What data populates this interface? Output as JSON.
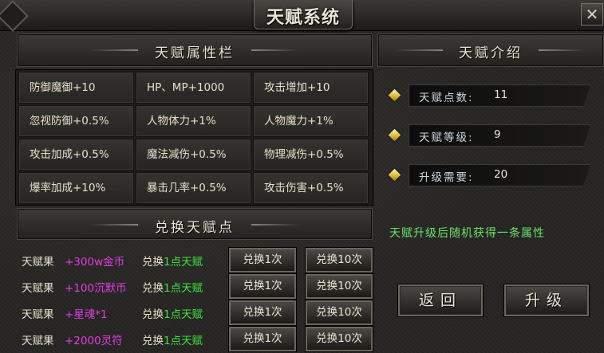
{
  "window": {
    "title": "天赋系统",
    "close_glyph": "✕"
  },
  "attr_panel": {
    "header": "天赋属性栏",
    "cells": [
      "防御魔御+10",
      "HP、MP+1000",
      "攻击增加+10",
      "忽视防御+0.5%",
      "人物体力+1%",
      "人物魔力+1%",
      "攻击加成+0.5%",
      "魔法减伤+0.5%",
      "物理减伤+0.5%",
      "爆率加成+10%",
      "暴击几率+0.5%",
      "攻击伤害+0.5%"
    ]
  },
  "intro_panel": {
    "header": "天赋介绍",
    "rows": [
      {
        "label": "天赋点数:",
        "value": "11"
      },
      {
        "label": "天赋等级:",
        "value": "9"
      },
      {
        "label": "升级需要:",
        "value": "20"
      }
    ],
    "description": "天赋升级后随机获得一条属性",
    "back_label": "返回",
    "upgrade_label": "升级"
  },
  "exchange_panel": {
    "header": "兑换天赋点",
    "rows": [
      {
        "name": "天赋果",
        "item": "+300w金币",
        "item_color": "#e33ce3",
        "desc_prefix": "兑换",
        "desc_amount": "1点天赋",
        "btn1": "兑换1次",
        "btn10": "兑换10次"
      },
      {
        "name": "天赋果",
        "item": "+100沉默币",
        "item_color": "#e33ce3",
        "desc_prefix": "兑换",
        "desc_amount": "1点天赋",
        "btn1": "兑换1次",
        "btn10": "兑换10次"
      },
      {
        "name": "天赋果",
        "item": "+星魂*1",
        "item_color": "#e33ce3",
        "desc_prefix": "兑换",
        "desc_amount": "1点天赋",
        "btn1": "兑换1次",
        "btn10": "兑换10次"
      },
      {
        "name": "天赋果",
        "item": "+2000灵符",
        "item_color": "#e33ce3",
        "desc_prefix": "兑换",
        "desc_amount": "1点天赋",
        "btn1": "兑换1次",
        "btn10": "兑换10次"
      }
    ]
  }
}
